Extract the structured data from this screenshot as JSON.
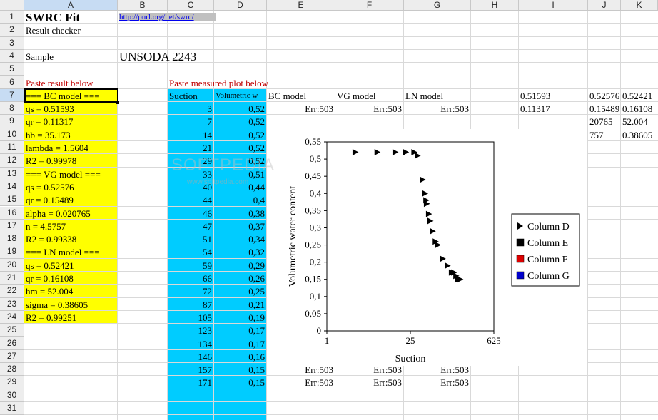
{
  "columns": [
    "A",
    "B",
    "C",
    "D",
    "E",
    "F",
    "G",
    "H",
    "I",
    "J",
    "K"
  ],
  "rows": [
    1,
    2,
    3,
    4,
    5,
    6,
    7,
    8,
    9,
    10,
    11,
    12,
    13,
    14,
    15,
    16,
    17,
    18,
    19,
    20,
    21,
    22,
    23,
    24,
    25,
    26,
    27,
    28,
    29,
    30,
    31
  ],
  "selected_cell": "A7",
  "title": "SWRC Fit",
  "subtitle": "Result checker",
  "link": "http://purl.org/net/swrc/",
  "sample_label": "Sample",
  "sample_value": "UNSODA 2243",
  "paste_result": "Paste result below",
  "paste_measured": "Paste measured plot below",
  "results": [
    "=== BC model ===",
    "qs = 0.51593",
    "qr = 0.11317",
    "hb = 35.173",
    "lambda = 1.5604",
    "R2 = 0.99978",
    "=== VG model ===",
    "qs = 0.52576",
    "qr = 0.15489",
    "alpha = 0.020765",
    "n = 4.5757",
    "R2 = 0.99338",
    "=== LN model ===",
    "qs = 0.52421",
    "qr = 0.16108",
    "hm = 52.004",
    "sigma = 0.38605",
    "R2 = 0.99251"
  ],
  "col_c_header": "Suction",
  "col_d_header": "Volumetric w",
  "suction": [
    "3",
    "7",
    "14",
    "21",
    "29",
    "33",
    "40",
    "44",
    "46",
    "47",
    "51",
    "54",
    "59",
    "66",
    "72",
    "87",
    "105",
    "123",
    "134",
    "146",
    "157",
    "171"
  ],
  "volumetric": [
    "0,52",
    "0,52",
    "0,52",
    "0,52",
    "0,52",
    "0,51",
    "0,44",
    "0,4",
    "0,38",
    "0,37",
    "0,34",
    "0,32",
    "0,29",
    "0,26",
    "0,25",
    "0,21",
    "0,19",
    "0,17",
    "0,17",
    "0,16",
    "0,15",
    "0,15"
  ],
  "model_headers": [
    "BC model",
    "VG model",
    "LN model"
  ],
  "err": "Err:503",
  "col_i": [
    "0.51593",
    "0.11317",
    "",
    ""
  ],
  "col_j": [
    "0.52576",
    "0.15489",
    "20765",
    "757"
  ],
  "col_k": [
    "0.52421",
    "0.16108",
    "52.004",
    "0.38605"
  ],
  "watermark": "SOFTPEDIA",
  "watermark_url": "www.softpedia.com",
  "chart_data": {
    "type": "scatter",
    "xlabel": "Suction",
    "ylabel": "Volumetric water content",
    "x_scale": "log",
    "xlim": [
      1,
      625
    ],
    "ylim": [
      0,
      0.55
    ],
    "x_ticks": [
      "1",
      "25",
      "625"
    ],
    "y_ticks": [
      "0",
      "0,05",
      "0,1",
      "0,15",
      "0,2",
      "0,25",
      "0,3",
      "0,35",
      "0,4",
      "0,45",
      "0,5",
      "0,55"
    ],
    "legend_position": "right",
    "series": [
      {
        "name": "Column D",
        "marker": "triangle-right",
        "color": "#000000",
        "x": [
          3,
          7,
          14,
          21,
          29,
          33,
          40,
          44,
          46,
          47,
          51,
          54,
          59,
          66,
          72,
          87,
          105,
          123,
          134,
          146,
          157,
          171
        ],
        "y": [
          0.52,
          0.52,
          0.52,
          0.52,
          0.52,
          0.51,
          0.44,
          0.4,
          0.38,
          0.37,
          0.34,
          0.32,
          0.29,
          0.26,
          0.25,
          0.21,
          0.19,
          0.17,
          0.17,
          0.16,
          0.15,
          0.15
        ]
      },
      {
        "name": "Column E",
        "marker": "square",
        "color": "#000000",
        "x": [],
        "y": []
      },
      {
        "name": "Column F",
        "marker": "square",
        "color": "#dd0000",
        "x": [],
        "y": []
      },
      {
        "name": "Column G",
        "marker": "square",
        "color": "#0000cc",
        "x": [],
        "y": []
      }
    ]
  }
}
